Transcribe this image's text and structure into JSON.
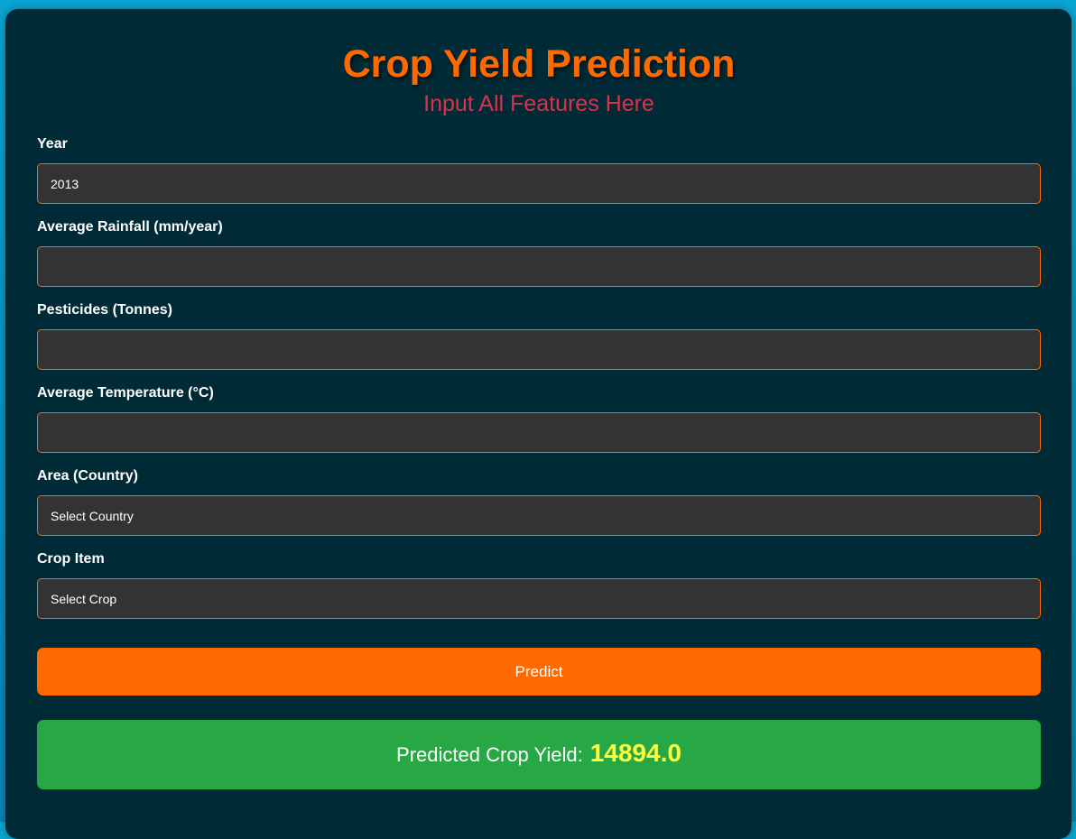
{
  "header": {
    "title": "Crop Yield Prediction",
    "subtitle": "Input All Features Here"
  },
  "form": {
    "year": {
      "label": "Year",
      "value": "2013"
    },
    "rainfall": {
      "label": "Average Rainfall (mm/year)",
      "value": ""
    },
    "pesticides": {
      "label": "Pesticides (Tonnes)",
      "value": ""
    },
    "temperature": {
      "label": "Average Temperature (°C)",
      "value": ""
    },
    "area": {
      "label": "Area (Country)",
      "selected": "Select Country"
    },
    "crop": {
      "label": "Crop Item",
      "selected": "Select Crop"
    },
    "predict_label": "Predict"
  },
  "result": {
    "label": "Predicted Crop Yield:",
    "value": "14894.0"
  },
  "colors": {
    "accent": "#ff6a00",
    "card_background": "#002b36",
    "subtitle": "#d8334a",
    "result_background": "#28a745",
    "result_value": "#ffff3b"
  }
}
